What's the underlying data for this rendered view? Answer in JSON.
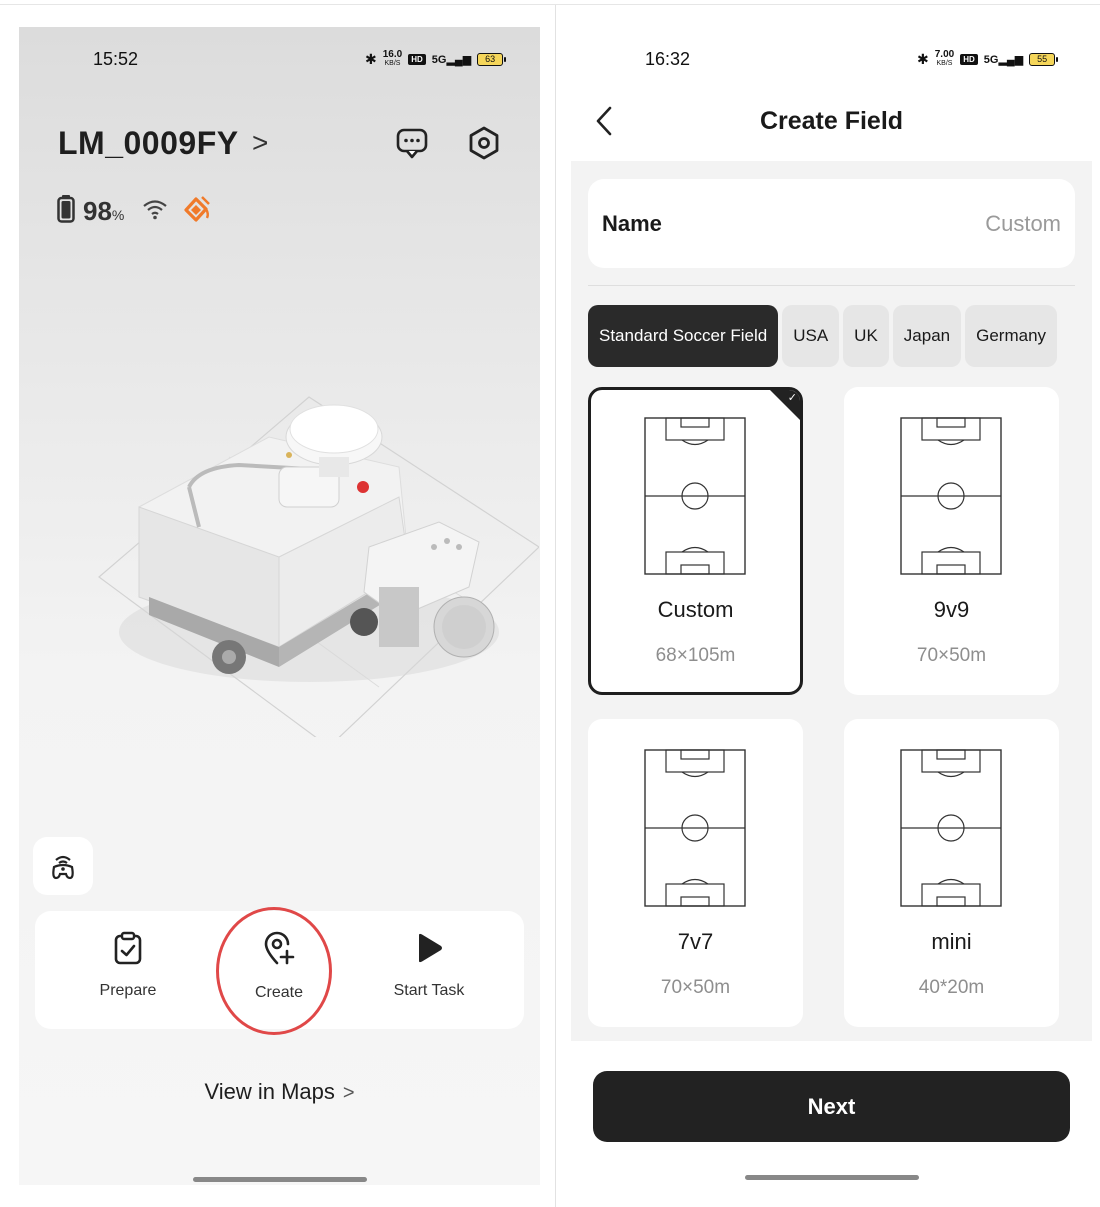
{
  "left": {
    "status": {
      "time": "15:52",
      "speed": "16.0",
      "speed_unit": "KB/S",
      "hd": "HD",
      "net": "5G",
      "battery": "63"
    },
    "device": {
      "name": "LM_0009FY",
      "chevron": ">"
    },
    "battery": {
      "value": "98",
      "unit": "%"
    },
    "actions": [
      {
        "label": "Prepare"
      },
      {
        "label": "Create"
      },
      {
        "label": "Start Task"
      }
    ],
    "view_maps": {
      "label": "View in Maps",
      "chevron": ">"
    }
  },
  "right": {
    "status": {
      "time": "16:32",
      "speed": "7.00",
      "speed_unit": "KB/S",
      "hd": "HD",
      "net": "5G",
      "battery": "55"
    },
    "header": {
      "title": "Create Field",
      "back": "<"
    },
    "name_field": {
      "label": "Name",
      "value": "Custom"
    },
    "tabs": [
      {
        "label": "Standard Soccer Field",
        "active": true
      },
      {
        "label": "USA",
        "active": false
      },
      {
        "label": "UK",
        "active": false
      },
      {
        "label": "Japan",
        "active": false
      },
      {
        "label": "Germany",
        "active": false
      }
    ],
    "fields": [
      {
        "name": "Custom",
        "size": "68×105m",
        "selected": true
      },
      {
        "name": "9v9",
        "size": "70×50m",
        "selected": false
      },
      {
        "name": "7v7",
        "size": "70×50m",
        "selected": false
      },
      {
        "name": "mini",
        "size": "40*20m",
        "selected": false
      }
    ],
    "next_label": "Next"
  },
  "colors": {
    "accent_dark": "#222222",
    "highlight_red": "#e04848",
    "warning_orange": "#f07a2a"
  }
}
